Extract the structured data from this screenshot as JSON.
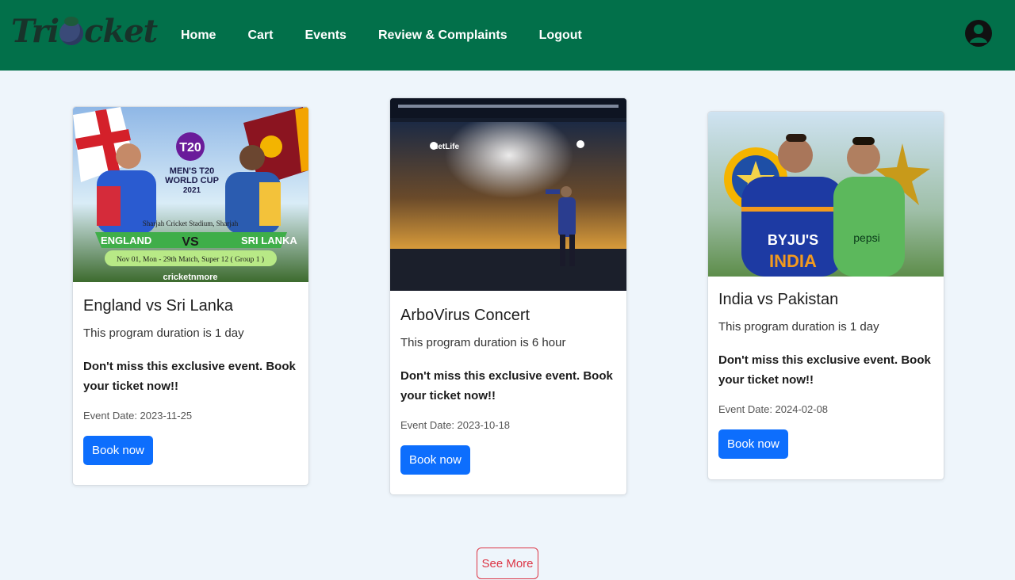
{
  "brand": {
    "logo_prefix": "Tri",
    "logo_suffix": "cket"
  },
  "nav": {
    "links": [
      "Home",
      "Cart",
      "Events",
      "Review & Complaints",
      "Logout"
    ]
  },
  "events": [
    {
      "title": "England vs Sri Lanka",
      "duration": "This program duration is 1 day",
      "cta": "Don't miss this exclusive event. Book your ticket now!!",
      "date": "Event Date: 2023-11-25",
      "button": "Book now",
      "image_text": {
        "left_team": "ENGLAND",
        "vs": "VS",
        "right_team": "SRI LANKA",
        "cup_line1": "MEN'S T20",
        "cup_line2": "WORLD CUP",
        "cup_year": "2021",
        "venue": "Sharjah Cricket Stadium, Sharjah",
        "match_info": "Nov 01, Mon - 29th Match, Super 12 ( Group 1 )",
        "site": "cricketnmore"
      }
    },
    {
      "title": "ArboVirus Concert",
      "duration": "This program duration is 6 hour",
      "cta": "Don't miss this exclusive event. Book your ticket now!!",
      "date": "Event Date: 2023-10-18",
      "button": "Book now",
      "image_text": {
        "sign": "MetLife"
      }
    },
    {
      "title": "India vs Pakistan",
      "duration": "This program duration is 1 day",
      "cta": "Don't miss this exclusive event. Book your ticket now!!",
      "date": "Event Date: 2024-02-08",
      "button": "Book now",
      "image_text": {
        "sponsor_left": "BYJU'S",
        "country_left": "INDIA",
        "sponsor_right": "pepsi"
      }
    }
  ],
  "see_more": "See More",
  "colors": {
    "navbar": "#02704a",
    "primary": "#0d6efd",
    "danger": "#dc3545",
    "background": "#eef5fb"
  }
}
